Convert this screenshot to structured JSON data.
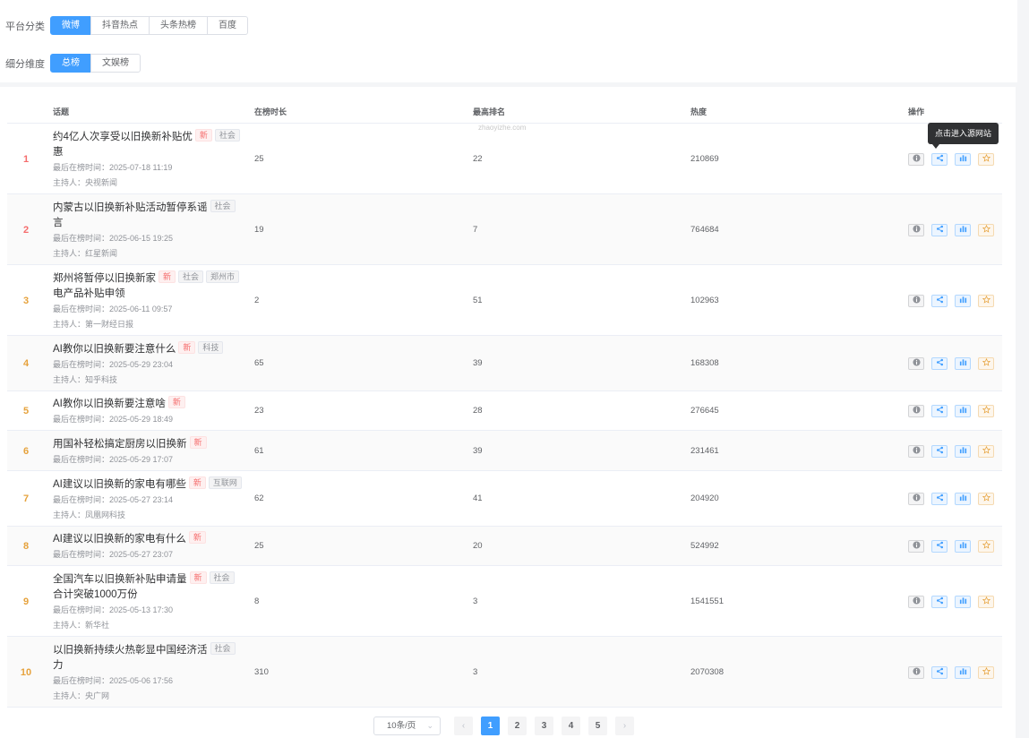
{
  "filters": {
    "platform": {
      "label": "平台分类",
      "options": [
        "微博",
        "抖音热点",
        "头条热榜",
        "百度"
      ],
      "active_index": 0
    },
    "dimension": {
      "label": "细分维度",
      "options": [
        "总榜",
        "文娱榜"
      ],
      "active_index": 0
    }
  },
  "table": {
    "headers": {
      "topic": "话题",
      "duration": "在榜时长",
      "best_rank": "最高排名",
      "heat": "热度",
      "actions": "操作"
    },
    "rows": [
      {
        "rank": "1",
        "title_lines": [
          "约4亿人次享受以旧换新补贴优",
          "惠"
        ],
        "tags": [
          {
            "text": "新",
            "type": "new"
          },
          {
            "text": "社会",
            "type": "cat"
          }
        ],
        "last_time": "最后在榜时间：2025-07-18 11:19",
        "host": "主持人：央视新闻",
        "duration": "25",
        "best_rank": "22",
        "heat": "210869"
      },
      {
        "rank": "2",
        "title_lines": [
          "内蒙古以旧换新补贴活动暂停系谣",
          "言"
        ],
        "tags": [
          {
            "text": "社会",
            "type": "cat"
          }
        ],
        "last_time": "最后在榜时间：2025-06-15 19:25",
        "host": "主持人：红星新闻",
        "duration": "19",
        "best_rank": "7",
        "heat": "764684"
      },
      {
        "rank": "3",
        "title_lines": [
          "郑州将暂停以旧换新家",
          "电产品补贴申领"
        ],
        "tags": [
          {
            "text": "新",
            "type": "new"
          },
          {
            "text": "社会",
            "type": "cat"
          },
          {
            "text": "郑州市",
            "type": "cat"
          }
        ],
        "last_time": "最后在榜时间：2025-06-11 09:57",
        "host": "主持人：第一财经日报",
        "duration": "2",
        "best_rank": "51",
        "heat": "102963"
      },
      {
        "rank": "4",
        "title_lines": [
          "AI教你以旧换新要注意什么"
        ],
        "tags": [
          {
            "text": "新",
            "type": "new"
          },
          {
            "text": "科技",
            "type": "cat"
          }
        ],
        "last_time": "最后在榜时间：2025-05-29 23:04",
        "host": "主持人：知乎科技",
        "duration": "65",
        "best_rank": "39",
        "heat": "168308"
      },
      {
        "rank": "5",
        "title_lines": [
          "AI教你以旧换新要注意啥"
        ],
        "tags": [
          {
            "text": "新",
            "type": "new"
          }
        ],
        "last_time": "最后在榜时间：2025-05-29 18:49",
        "host": "",
        "duration": "23",
        "best_rank": "28",
        "heat": "276645"
      },
      {
        "rank": "6",
        "title_lines": [
          "用国补轻松搞定厨房以旧换新"
        ],
        "tags": [
          {
            "text": "新",
            "type": "new"
          }
        ],
        "last_time": "最后在榜时间：2025-05-29 17:07",
        "host": "",
        "duration": "61",
        "best_rank": "39",
        "heat": "231461"
      },
      {
        "rank": "7",
        "title_lines": [
          "AI建议以旧换新的家电有哪些"
        ],
        "tags": [
          {
            "text": "新",
            "type": "new"
          },
          {
            "text": "互联网",
            "type": "cat"
          }
        ],
        "last_time": "最后在榜时间：2025-05-27 23:14",
        "host": "主持人：凤凰网科技",
        "duration": "62",
        "best_rank": "41",
        "heat": "204920"
      },
      {
        "rank": "8",
        "title_lines": [
          "AI建议以旧换新的家电有什么"
        ],
        "tags": [
          {
            "text": "新",
            "type": "new"
          }
        ],
        "last_time": "最后在榜时间：2025-05-27 23:07",
        "host": "",
        "duration": "25",
        "best_rank": "20",
        "heat": "524992"
      },
      {
        "rank": "9",
        "title_lines": [
          "全国汽车以旧换新补贴申请量",
          "合计突破1000万份"
        ],
        "tags": [
          {
            "text": "新",
            "type": "new"
          },
          {
            "text": "社会",
            "type": "cat"
          }
        ],
        "last_time": "最后在榜时间：2025-05-13 17:30",
        "host": "主持人：新华社",
        "duration": "8",
        "best_rank": "3",
        "heat": "1541551"
      },
      {
        "rank": "10",
        "title_lines": [
          "以旧换新持续火热彰显中国经济活",
          "力"
        ],
        "tags": [
          {
            "text": "社会",
            "type": "cat"
          }
        ],
        "last_time": "最后在榜时间：2025-05-06 17:56",
        "host": "主持人：央广网",
        "duration": "310",
        "best_rank": "3",
        "heat": "2070308"
      }
    ]
  },
  "tooltip": {
    "text": "点击进入源网站"
  },
  "watermark": {
    "text": "zhaoyizhe.com"
  },
  "pagination": {
    "page_size": "10条/页",
    "pages": [
      "1",
      "2",
      "3",
      "4",
      "5"
    ],
    "current": "1",
    "prev": "‹",
    "next": "›"
  },
  "colors": {
    "primary": "#409eff",
    "rank_top": "#f56c6c",
    "rank_other": "#e6a23c",
    "new_tag": "#f56c6c"
  }
}
